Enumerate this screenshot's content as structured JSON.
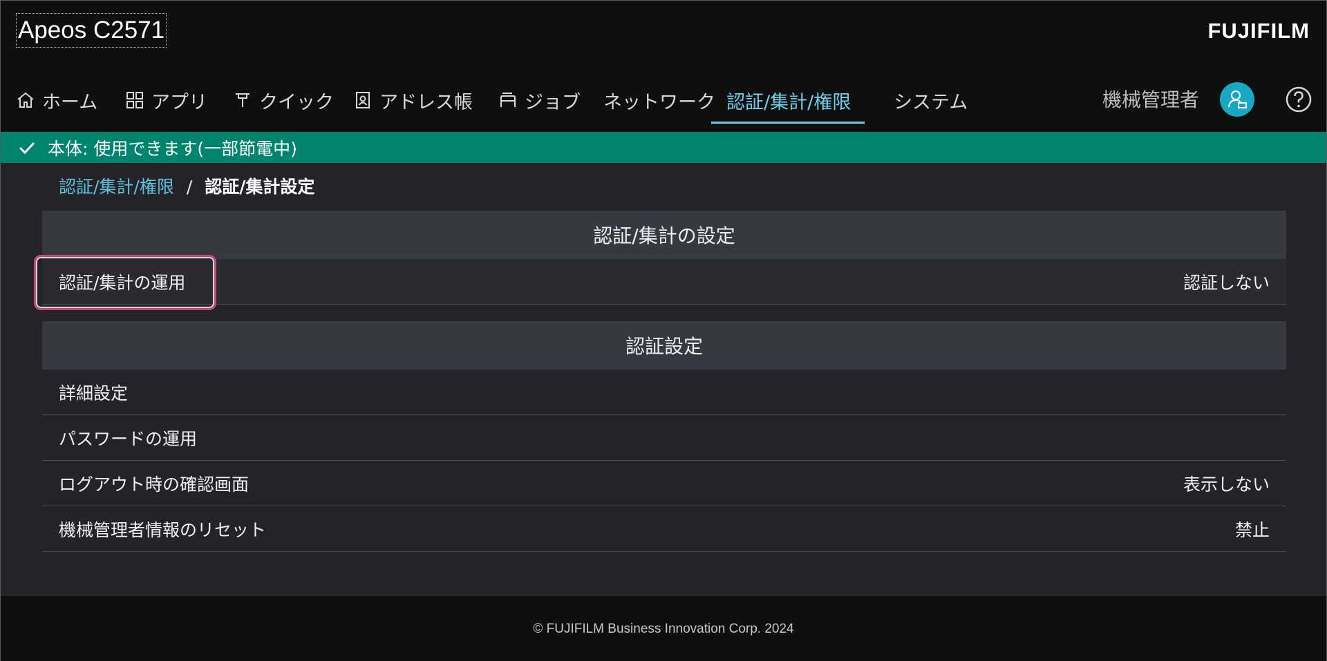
{
  "header": {
    "model_name": "Apeos C2571",
    "brand": "FUJIFILM"
  },
  "nav": {
    "items": [
      {
        "label": "ホーム",
        "icon": "home-icon"
      },
      {
        "label": "アプリ",
        "icon": "apps-icon"
      },
      {
        "label": "クイック",
        "icon": "quick-icon"
      },
      {
        "label": "アドレス帳",
        "icon": "address-book-icon"
      },
      {
        "label": "ジョブ",
        "icon": "job-icon"
      },
      {
        "label": "ネットワーク",
        "icon": ""
      },
      {
        "label": "認証/集計/権限",
        "icon": "",
        "active": true
      },
      {
        "label": "システム",
        "icon": ""
      }
    ],
    "user_label": "機械管理者",
    "user_icon": "admin-user-icon",
    "help_icon": "help-icon"
  },
  "status": {
    "icon": "check-icon",
    "text": "本体: 使用できます(一部節電中)",
    "color": "#00846e"
  },
  "breadcrumb": {
    "parent": "認証/集計/権限",
    "separator": "/",
    "current": "認証/集計設定"
  },
  "sections": [
    {
      "title": "認証/集計の設定",
      "rows": [
        {
          "label": "認証/集計の運用",
          "value": "認証しない"
        }
      ]
    },
    {
      "title": "認証設定",
      "rows": [
        {
          "label": "詳細設定",
          "value": ""
        },
        {
          "label": "パスワードの運用",
          "value": ""
        },
        {
          "label": "ログアウト時の確認画面",
          "value": "表示しない"
        },
        {
          "label": "機械管理者情報のリセット",
          "value": "禁止"
        }
      ]
    }
  ],
  "footer": {
    "copyright": "© FUJIFILM Business Innovation Corp. 2024"
  },
  "colors": {
    "accent": "#6cd0ea",
    "status_green": "#00846e",
    "focus_ring": "#c04a7c"
  }
}
